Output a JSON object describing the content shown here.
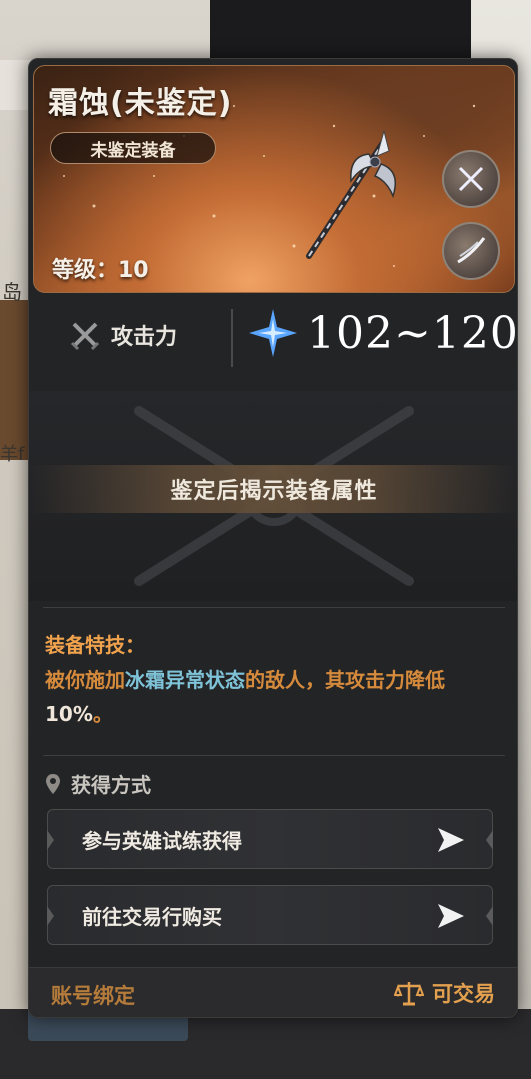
{
  "background": {
    "left_text_1": "岛",
    "left_text_2": "羊f"
  },
  "item": {
    "title": "霜蚀(未鉴定)",
    "tag": "未鉴定装备",
    "level_text": "等级：10",
    "side_icons": [
      "crossed-swords-icon",
      "blade-slash-icon"
    ]
  },
  "stat": {
    "label": "攻击力",
    "value": "102~120",
    "label_icon": "crossed-swords-icon",
    "value_icon": "frost-star-icon"
  },
  "locked": {
    "banner": "鉴定后揭示装备属性"
  },
  "skill": {
    "title": "装备特技：",
    "desc_part1": "被你施加",
    "desc_highlight": "冰霜异常状态",
    "desc_part2": "的敌人，其攻击力降低",
    "desc_number": "10%",
    "desc_part3": "。"
  },
  "source": {
    "title": "获得方式",
    "items": [
      {
        "label": "参与英雄试练获得"
      },
      {
        "label": "前往交易行购买"
      }
    ]
  },
  "footer": {
    "bind": "账号绑定",
    "trade": "可交易"
  },
  "colors": {
    "accent_orange": "#f0a24d",
    "highlight_blue": "#7fc3d8",
    "card_bg": "#232426"
  }
}
